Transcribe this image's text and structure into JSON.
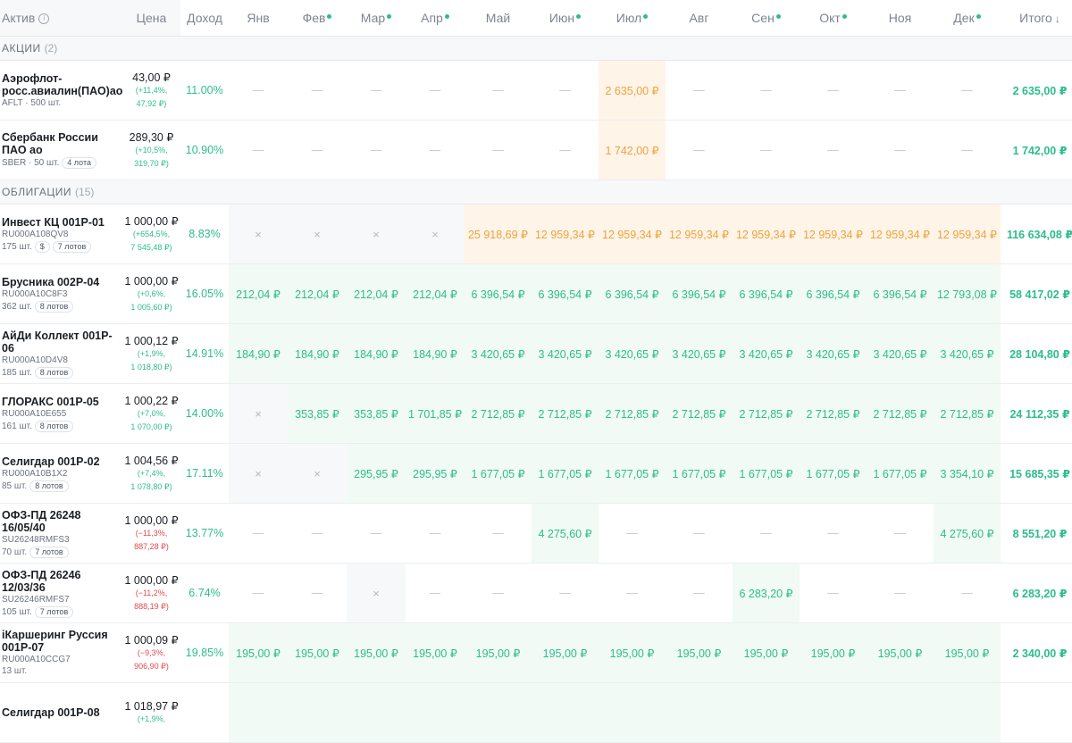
{
  "header": {
    "asset": "Актив",
    "price": "Цена",
    "yield": "Доход",
    "months": [
      {
        "label": "Янв",
        "dot": false
      },
      {
        "label": "Фев",
        "dot": true
      },
      {
        "label": "Мар",
        "dot": true
      },
      {
        "label": "Апр",
        "dot": true
      },
      {
        "label": "Май",
        "dot": false
      },
      {
        "label": "Июн",
        "dot": true
      },
      {
        "label": "Июл",
        "dot": true
      },
      {
        "label": "Авг",
        "dot": false
      },
      {
        "label": "Сен",
        "dot": true
      },
      {
        "label": "Окт",
        "dot": true
      },
      {
        "label": "Ноя",
        "dot": false
      },
      {
        "label": "Дек",
        "dot": true
      }
    ],
    "total": "Итого",
    "info_icon": "info-icon",
    "sort_icon": "arrow-down-icon"
  },
  "colors": {
    "green": "#2dbd8c",
    "orange": "#f0a23b",
    "red": "#e5484d"
  },
  "sections": [
    {
      "title": "АКЦИИ",
      "count": "(2)",
      "rows": [
        {
          "name": "Аэрофлот-росс.авиалин(ПАО)ао",
          "meta": "AFLT · 500 шт.",
          "tags": [],
          "price": "43,00 ₽",
          "chg": "(+11,4%,",
          "chg2": "47,92 ₽)",
          "dir": "pos",
          "yield": "11.00%",
          "months": [
            [
              "—",
              "dash"
            ],
            [
              "—",
              "dash"
            ],
            [
              "—",
              "dash"
            ],
            [
              "—",
              "dash"
            ],
            [
              "—",
              "dash"
            ],
            [
              "—",
              "dash"
            ],
            [
              "2 635,00 ₽",
              "o"
            ],
            [
              "—",
              "dash"
            ],
            [
              "—",
              "dash"
            ],
            [
              "—",
              "dash"
            ],
            [
              "—",
              "dash"
            ],
            [
              "—",
              "dash"
            ]
          ],
          "total": "2 635,00 ₽"
        },
        {
          "name": "Сбербанк России ПАО ао",
          "meta": "SBER · 50 шт.",
          "tags": [
            "4 лота"
          ],
          "price": "289,30 ₽",
          "chg": "(+10,5%,",
          "chg2": "319,70 ₽)",
          "dir": "pos",
          "yield": "10.90%",
          "months": [
            [
              "—",
              "dash"
            ],
            [
              "—",
              "dash"
            ],
            [
              "—",
              "dash"
            ],
            [
              "—",
              "dash"
            ],
            [
              "—",
              "dash"
            ],
            [
              "—",
              "dash"
            ],
            [
              "1 742,00 ₽",
              "o"
            ],
            [
              "—",
              "dash"
            ],
            [
              "—",
              "dash"
            ],
            [
              "—",
              "dash"
            ],
            [
              "—",
              "dash"
            ],
            [
              "—",
              "dash"
            ]
          ],
          "total": "1 742,00 ₽"
        }
      ]
    },
    {
      "title": "ОБЛИГАЦИИ",
      "count": "(15)",
      "rows": [
        {
          "name": "Инвест КЦ 001P-01",
          "meta": "RU000A108QV8",
          "meta2": "175 шт.",
          "tags": [
            "$",
            "7 лотов"
          ],
          "price": "1 000,00 ₽",
          "chg": "(+654,5%,",
          "chg2": "7 545,48 ₽)",
          "dir": "pos",
          "yield": "8.83%",
          "months": [
            [
              "×",
              "x"
            ],
            [
              "×",
              "x"
            ],
            [
              "×",
              "x"
            ],
            [
              "×",
              "x"
            ],
            [
              "25 918,69 ₽",
              "o"
            ],
            [
              "12 959,34 ₽",
              "o"
            ],
            [
              "12 959,34 ₽",
              "o"
            ],
            [
              "12 959,34 ₽",
              "o"
            ],
            [
              "12 959,34 ₽",
              "o"
            ],
            [
              "12 959,34 ₽",
              "o"
            ],
            [
              "12 959,34 ₽",
              "o"
            ],
            [
              "12 959,34 ₽",
              "o"
            ]
          ],
          "total": "116 634,08 ₽"
        },
        {
          "name": "Брусника 002P-04",
          "meta": "RU000A10C8F3",
          "meta2": "362 шт.",
          "tags": [
            "8 лотов"
          ],
          "price": "1 000,00 ₽",
          "chg": "(+0,6%,",
          "chg2": "1 005,60 ₽)",
          "dir": "pos",
          "yield": "16.05%",
          "months": [
            [
              "212,04 ₽",
              "g"
            ],
            [
              "212,04 ₽",
              "g"
            ],
            [
              "212,04 ₽",
              "g"
            ],
            [
              "212,04 ₽",
              "g"
            ],
            [
              "6 396,54 ₽",
              "g"
            ],
            [
              "6 396,54 ₽",
              "g"
            ],
            [
              "6 396,54 ₽",
              "g"
            ],
            [
              "6 396,54 ₽",
              "g"
            ],
            [
              "6 396,54 ₽",
              "g"
            ],
            [
              "6 396,54 ₽",
              "g"
            ],
            [
              "6 396,54 ₽",
              "g"
            ],
            [
              "12 793,08 ₽",
              "g"
            ]
          ],
          "total": "58 417,02 ₽"
        },
        {
          "name": "АйДи Коллект 001P-06",
          "meta": "RU000A10D4V8",
          "meta2": "185 шт.",
          "tags": [
            "8 лотов"
          ],
          "price": "1 000,12 ₽",
          "chg": "(+1,9%,",
          "chg2": "1 018,80 ₽)",
          "dir": "pos",
          "yield": "14.91%",
          "months": [
            [
              "184,90 ₽",
              "g"
            ],
            [
              "184,90 ₽",
              "g"
            ],
            [
              "184,90 ₽",
              "g"
            ],
            [
              "184,90 ₽",
              "g"
            ],
            [
              "3 420,65 ₽",
              "g"
            ],
            [
              "3 420,65 ₽",
              "g"
            ],
            [
              "3 420,65 ₽",
              "g"
            ],
            [
              "3 420,65 ₽",
              "g"
            ],
            [
              "3 420,65 ₽",
              "g"
            ],
            [
              "3 420,65 ₽",
              "g"
            ],
            [
              "3 420,65 ₽",
              "g"
            ],
            [
              "3 420,65 ₽",
              "g"
            ]
          ],
          "total": "28 104,80 ₽"
        },
        {
          "name": "ГЛОРАКС 001P-05",
          "meta": "RU000A10E655",
          "meta2": "161 шт.",
          "tags": [
            "8 лотов"
          ],
          "price": "1 000,22 ₽",
          "chg": "(+7,0%,",
          "chg2": "1 070,00 ₽)",
          "dir": "pos",
          "yield": "14.00%",
          "months": [
            [
              "×",
              "x"
            ],
            [
              "353,85 ₽",
              "g"
            ],
            [
              "353,85 ₽",
              "g"
            ],
            [
              "1 701,85 ₽",
              "g"
            ],
            [
              "2 712,85 ₽",
              "g"
            ],
            [
              "2 712,85 ₽",
              "g"
            ],
            [
              "2 712,85 ₽",
              "g"
            ],
            [
              "2 712,85 ₽",
              "g"
            ],
            [
              "2 712,85 ₽",
              "g"
            ],
            [
              "2 712,85 ₽",
              "g"
            ],
            [
              "2 712,85 ₽",
              "g"
            ],
            [
              "2 712,85 ₽",
              "g"
            ]
          ],
          "total": "24 112,35 ₽"
        },
        {
          "name": "Селигдар 001P-02",
          "meta": "RU000A10B1X2",
          "meta2": "85 шт.",
          "tags": [
            "8 лотов"
          ],
          "price": "1 004,56 ₽",
          "chg": "(+7,4%,",
          "chg2": "1 078,80 ₽)",
          "dir": "pos",
          "yield": "17.11%",
          "months": [
            [
              "×",
              "x"
            ],
            [
              "×",
              "x"
            ],
            [
              "295,95 ₽",
              "g"
            ],
            [
              "295,95 ₽",
              "g"
            ],
            [
              "1 677,05 ₽",
              "g"
            ],
            [
              "1 677,05 ₽",
              "g"
            ],
            [
              "1 677,05 ₽",
              "g"
            ],
            [
              "1 677,05 ₽",
              "g"
            ],
            [
              "1 677,05 ₽",
              "g"
            ],
            [
              "1 677,05 ₽",
              "g"
            ],
            [
              "1 677,05 ₽",
              "g"
            ],
            [
              "3 354,10 ₽",
              "g"
            ]
          ],
          "total": "15 685,35 ₽"
        },
        {
          "name": "ОФЗ-ПД 26248 16/05/40",
          "meta": "SU26248RMFS3",
          "meta2": "70 шт.",
          "tags": [
            "7 лотов"
          ],
          "price": "1 000,00 ₽",
          "chg": "(−11,3%,",
          "chg2": "887,28 ₽)",
          "dir": "neg",
          "yield": "13.77%",
          "months": [
            [
              "—",
              "dash"
            ],
            [
              "—",
              "dash"
            ],
            [
              "—",
              "dash"
            ],
            [
              "—",
              "dash"
            ],
            [
              "—",
              "dash"
            ],
            [
              "4 275,60 ₽",
              "g"
            ],
            [
              "—",
              "dash"
            ],
            [
              "—",
              "dash"
            ],
            [
              "—",
              "dash"
            ],
            [
              "—",
              "dash"
            ],
            [
              "—",
              "dash"
            ],
            [
              "4 275,60 ₽",
              "g"
            ]
          ],
          "total": "8 551,20 ₽"
        },
        {
          "name": "ОФЗ-ПД 26246 12/03/36",
          "meta": "SU26246RMFS7",
          "meta2": "105 шт.",
          "tags": [
            "7 лотов"
          ],
          "price": "1 000,00 ₽",
          "chg": "(−11,2%,",
          "chg2": "888,19 ₽)",
          "dir": "neg",
          "yield": "6.74%",
          "months": [
            [
              "—",
              "dash"
            ],
            [
              "—",
              "dash"
            ],
            [
              "×",
              "x"
            ],
            [
              "—",
              "dash"
            ],
            [
              "—",
              "dash"
            ],
            [
              "—",
              "dash"
            ],
            [
              "—",
              "dash"
            ],
            [
              "—",
              "dash"
            ],
            [
              "6 283,20 ₽",
              "g"
            ],
            [
              "—",
              "dash"
            ],
            [
              "—",
              "dash"
            ],
            [
              "—",
              "dash"
            ]
          ],
          "total": "6 283,20 ₽"
        },
        {
          "name": "iКаршеринг Руссия 001P-07",
          "meta": "RU000A10CCG7",
          "meta2": "13 шт.",
          "tags": [],
          "price": "1 000,09 ₽",
          "chg": "(−9,3%,",
          "chg2": "906,90 ₽)",
          "dir": "neg",
          "yield": "19.85%",
          "months": [
            [
              "195,00 ₽",
              "g"
            ],
            [
              "195,00 ₽",
              "g"
            ],
            [
              "195,00 ₽",
              "g"
            ],
            [
              "195,00 ₽",
              "g"
            ],
            [
              "195,00 ₽",
              "g"
            ],
            [
              "195,00 ₽",
              "g"
            ],
            [
              "195,00 ₽",
              "g"
            ],
            [
              "195,00 ₽",
              "g"
            ],
            [
              "195,00 ₽",
              "g"
            ],
            [
              "195,00 ₽",
              "g"
            ],
            [
              "195,00 ₽",
              "g"
            ],
            [
              "195,00 ₽",
              "g"
            ]
          ],
          "total": "2 340,00 ₽"
        },
        {
          "name": "Селигдар 001P-08",
          "meta": "",
          "meta2": "",
          "tags": [],
          "price": "1 018,97 ₽",
          "chg": "(+1,9%,",
          "chg2": "",
          "dir": "pos",
          "yield": "",
          "months": [
            [
              "",
              "g"
            ],
            [
              "",
              "g"
            ],
            [
              "",
              "g"
            ],
            [
              "",
              "g"
            ],
            [
              "",
              "g"
            ],
            [
              "",
              "g"
            ],
            [
              "",
              "g"
            ],
            [
              "",
              "g"
            ],
            [
              "",
              "g"
            ],
            [
              "",
              "g"
            ],
            [
              "",
              "g"
            ],
            [
              "",
              "g"
            ]
          ],
          "total": ""
        }
      ]
    }
  ]
}
